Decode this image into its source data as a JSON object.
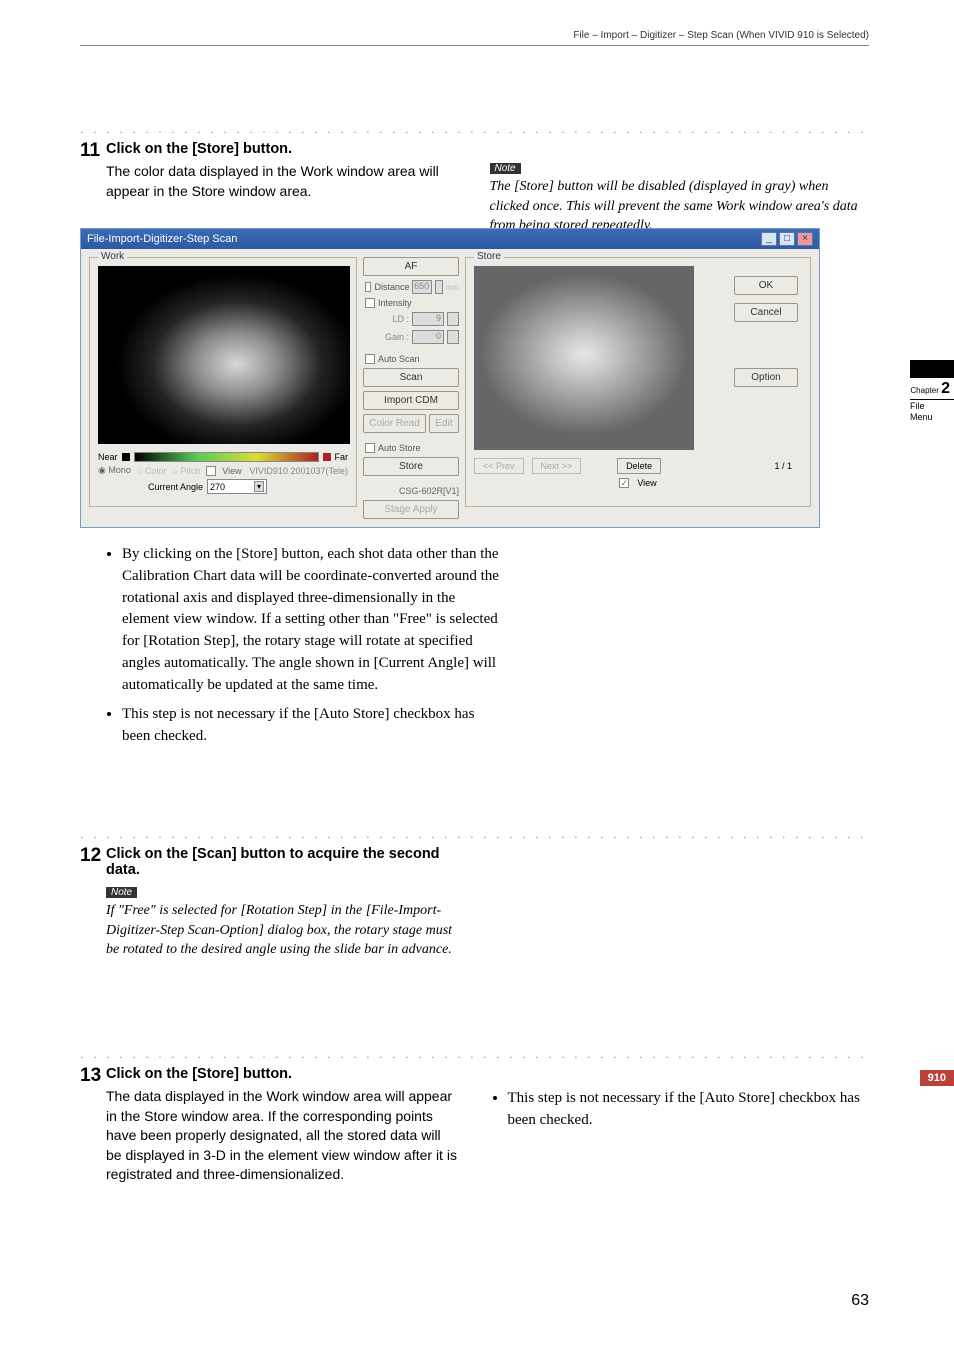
{
  "header": {
    "breadcrumb": "File – Import – Digitizer – Step Scan (When VIVID 910 is Selected)"
  },
  "sidebar": {
    "chapter_label": "Chapter",
    "chapter_num": "2",
    "sub1": "File",
    "sub2": "Menu",
    "badge": "910"
  },
  "page_number": "63",
  "step11": {
    "num": "11",
    "title": "Click on the [Store] button.",
    "text": "The color data displayed in the Work window area will appear in the Store window area.",
    "note_tag": "Note",
    "note_body": "The [Store] button will be disabled (displayed in gray) when clicked once. This will prevent the same Work window area's data from being stored repeatedly.",
    "bullet1": "By clicking on the [Store] button, each shot data other than the Calibration Chart data will be coordinate-converted around the rotational axis and displayed three-dimensionally in the element view window. If a setting other than \"Free\" is selected for [Rotation Step], the rotary stage will rotate at specified angles automatically. The angle shown in [Current Angle] will automatically be updated at the same time.",
    "bullet2": "This step is not necessary if the [Auto Store] checkbox has been checked."
  },
  "step12": {
    "num": "12",
    "title": "Click on the [Scan] button to acquire the second data.",
    "note_tag": "Note",
    "note_body": "If \"Free\" is selected for [Rotation Step] in the [File-Import-Digitizer-Step Scan-Option] dialog box, the rotary stage must be rotated to the desired angle using the slide bar in advance."
  },
  "step13": {
    "num": "13",
    "title": "Click on the [Store] button.",
    "text": "The data displayed in the Work window area will appear in the Store window area. If the corresponding points have been properly designated, all the stored data will be displayed in 3-D in the element view window after it is registrated and three-dimensionalized.",
    "bullet1": "This step is not necessary if the [Auto Store] checkbox has been checked."
  },
  "dialog": {
    "title": "File-Import-Digitizer-Step Scan",
    "work_label": "Work",
    "store_label": "Store",
    "near": "Near",
    "far": "Far",
    "mono": "Mono",
    "color": "Color",
    "pitch": "Pitch",
    "view_chk": "View",
    "device": "VIVID910 2001037(Tele)",
    "current_angle_label": "Current Angle",
    "current_angle_val": "270",
    "btn_af": "AF",
    "distance": "Distance",
    "distance_val": "650",
    "distance_unit": "mm",
    "intensity": "Intensity",
    "ld": "LD :",
    "ld_val": "9",
    "gain": "Gain :",
    "gain_val": "0",
    "auto_scan": "Auto Scan",
    "btn_scan": "Scan",
    "btn_import_cdm": "Import CDM",
    "btn_color_read": "Color Read",
    "btn_edit": "Edit",
    "auto_store": "Auto Store",
    "btn_store": "Store",
    "stage_label": "CSG-602R[V1]",
    "btn_stage": "Stage Apply",
    "prev": "<< Prev",
    "next": "Next >>",
    "delete": "Delete",
    "counter": "1 / 1",
    "view": "View",
    "ok": "OK",
    "cancel": "Cancel",
    "option": "Option"
  }
}
